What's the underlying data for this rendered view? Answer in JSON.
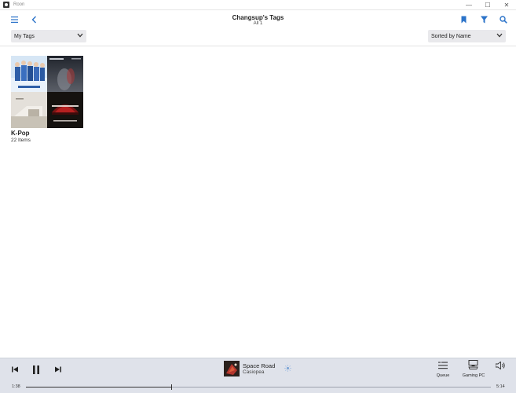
{
  "window": {
    "title": "Roon",
    "minimize": "—",
    "maximize": "☐",
    "close": "✕"
  },
  "header": {
    "title": "Changsup's Tags",
    "subtitle": "All 1"
  },
  "filters": {
    "view_select": "My Tags",
    "sort_select": "Sorted by Name"
  },
  "tags": [
    {
      "name": "K-Pop",
      "count": "22 Items"
    }
  ],
  "player": {
    "track_title": "Space Road",
    "track_artist": "Casiopea",
    "queue_label": "Queue",
    "zone_label": "Gaming PC",
    "elapsed": "1:38",
    "duration": "5:14",
    "progress": 0.312
  },
  "colors": {
    "accent": "#2b73c9",
    "player_bg": "#dfe2ea"
  },
  "icons": [
    "hamburger-icon",
    "back-icon",
    "bookmark-icon",
    "filter-icon",
    "search-icon",
    "previous-icon",
    "pause-icon",
    "next-icon",
    "radio-icon",
    "queue-icon",
    "zone-icon",
    "volume-icon"
  ]
}
